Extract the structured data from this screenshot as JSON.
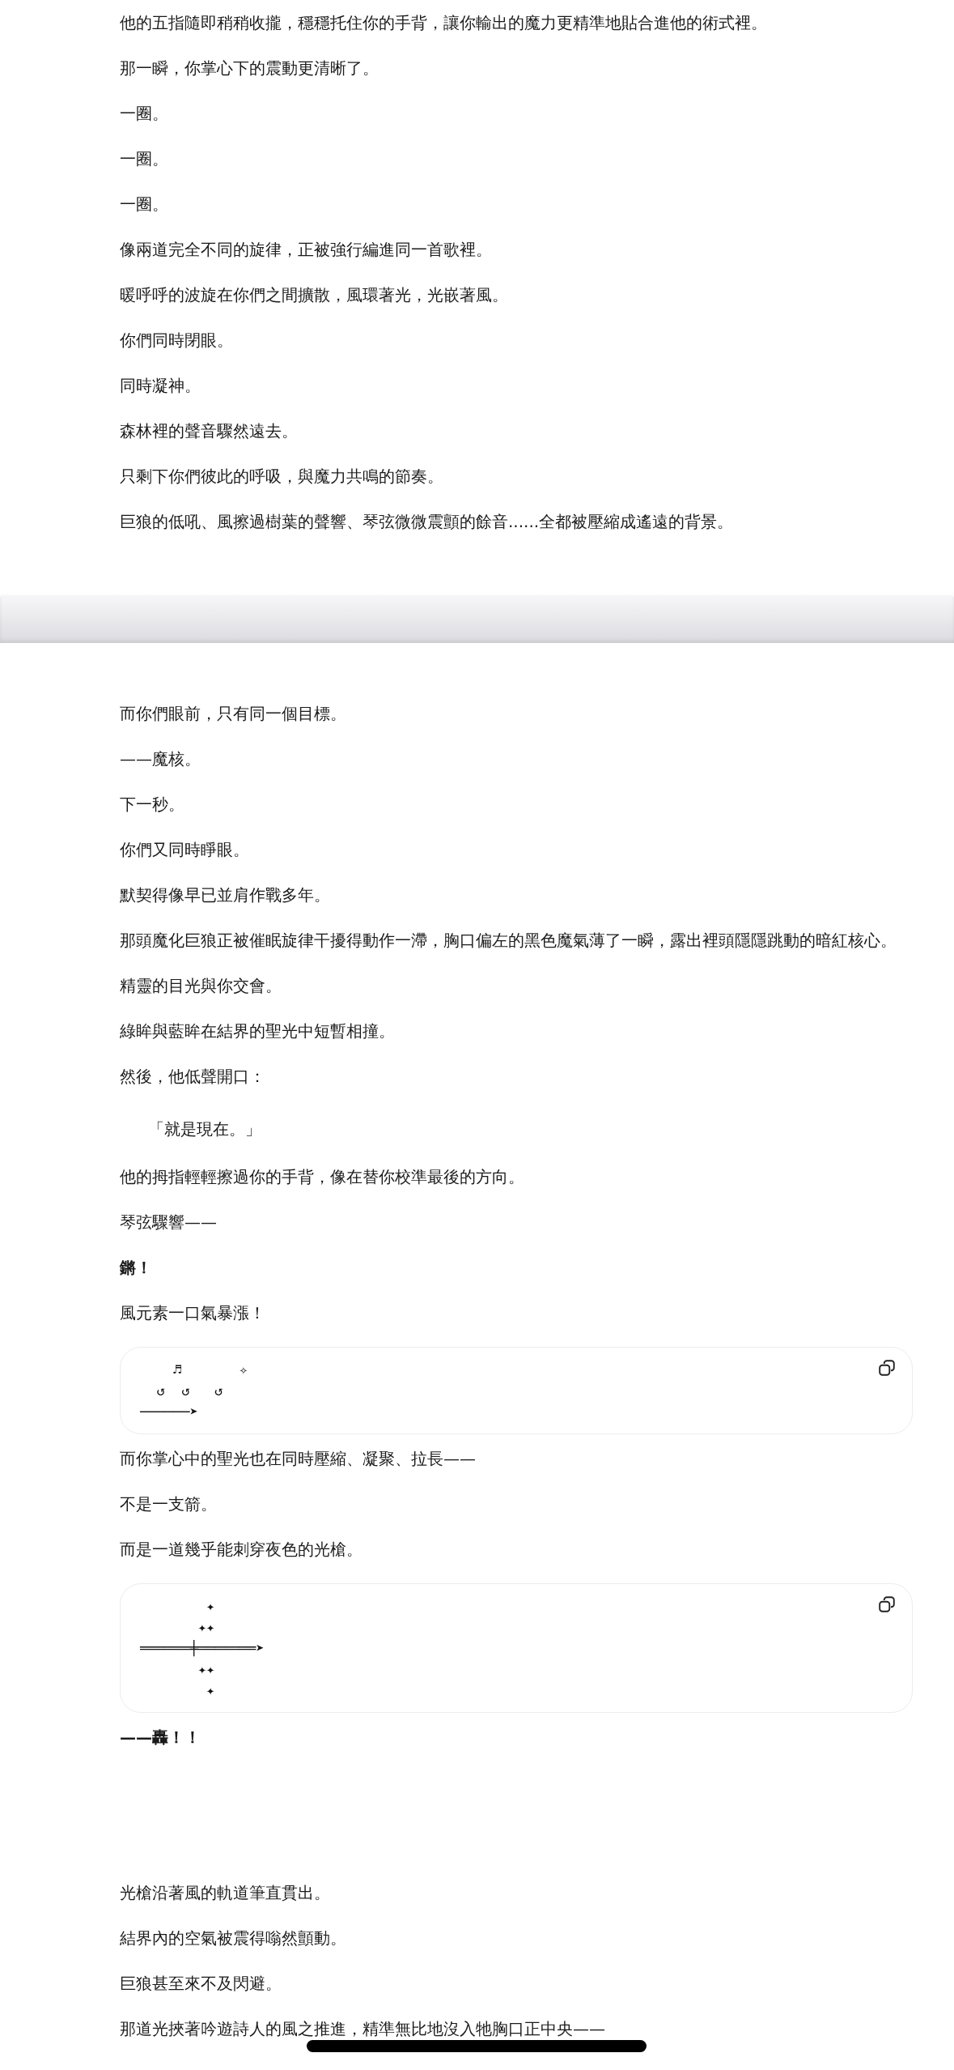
{
  "sections": [
    {
      "kind": "plain",
      "blocks": [
        {
          "kind": "text",
          "text": "他的五指隨即稍稍收攏，穩穩托住你的手背，讓你輸出的魔力更精準地貼合進他的術式裡。"
        },
        {
          "kind": "text",
          "text": "那一瞬，你掌心下的震動更清晰了。"
        },
        {
          "kind": "text",
          "text": "一圈。"
        },
        {
          "kind": "text",
          "text": "一圈。"
        },
        {
          "kind": "text",
          "text": "一圈。"
        },
        {
          "kind": "text",
          "text": "像兩道完全不同的旋律，正被強行編進同一首歌裡。"
        },
        {
          "kind": "text",
          "text": "暖呼呼的波旋在你們之間擴散，風環著光，光嵌著風。"
        },
        {
          "kind": "text",
          "text": "你們同時閉眼。"
        },
        {
          "kind": "text",
          "text": "同時凝神。"
        },
        {
          "kind": "text",
          "text": "森林裡的聲音驟然遠去。"
        },
        {
          "kind": "text",
          "text": "只剩下你們彼此的呼吸，與魔力共鳴的節奏。"
        },
        {
          "kind": "text",
          "text": "巨狼的低吼、風擦過樹葉的聲響、琴弦微微震顫的餘音......全都被壓縮成遙遠的背景。"
        }
      ]
    },
    {
      "kind": "band",
      "blocks": [
        {
          "kind": "text",
          "text": "而你們眼前，只有同一個目標。"
        },
        {
          "kind": "text",
          "text": "——魔核。"
        },
        {
          "kind": "text",
          "text": "下一秒。"
        },
        {
          "kind": "text",
          "text": "你們又同時睜眼。"
        },
        {
          "kind": "text",
          "text": "默契得像早已並肩作戰多年。"
        },
        {
          "kind": "text",
          "text": "那頭魔化巨狼正被催眠旋律干擾得動作一滯，胸口偏左的黑色魔氣薄了一瞬，露出裡頭隱隱跳動的暗紅核心。"
        },
        {
          "kind": "text",
          "text": "精靈的目光與你交會。"
        },
        {
          "kind": "text",
          "text": "綠眸與藍眸在結界的聖光中短暫相撞。"
        },
        {
          "kind": "text",
          "text": "然後，他低聲開口："
        },
        {
          "kind": "quote",
          "text": "「就是現在。」"
        },
        {
          "kind": "text",
          "text": "他的拇指輕輕擦過你的手背，像在替你校準最後的方向。"
        },
        {
          "kind": "text",
          "text": "琴弦驟響——"
        },
        {
          "kind": "bold",
          "text": "鏘！"
        },
        {
          "kind": "text",
          "text": "風元素一口氣暴漲！"
        },
        {
          "kind": "code",
          "lines": [
            "    ♬       ✧",
            "  ↺  ↺   ↺",
            "──────➤"
          ]
        },
        {
          "kind": "text",
          "text": "而你掌心中的聖光也在同時壓縮、凝聚、拉長——"
        },
        {
          "kind": "text",
          "text": "不是一支箭。"
        },
        {
          "kind": "text",
          "text": "而是一道幾乎能刺穿夜色的光槍。"
        },
        {
          "kind": "code",
          "lines": [
            "        ✦",
            "       ✦✦",
            "══════╪═══════➤",
            "       ✦✦",
            "        ✦"
          ]
        },
        {
          "kind": "bold",
          "text": "——轟！！"
        }
      ]
    },
    {
      "kind": "space",
      "blocks": [
        {
          "kind": "text",
          "text": "光槍沿著風的軌道筆直貫出。"
        },
        {
          "kind": "text",
          "text": "結界內的空氣被震得嗡然顫動。"
        },
        {
          "kind": "text",
          "text": "巨狼甚至來不及閃避。"
        },
        {
          "kind": "text",
          "text": "那道光挾著吟遊詩人的風之推進，精準無比地沒入牠胸口正中央——"
        }
      ]
    }
  ]
}
